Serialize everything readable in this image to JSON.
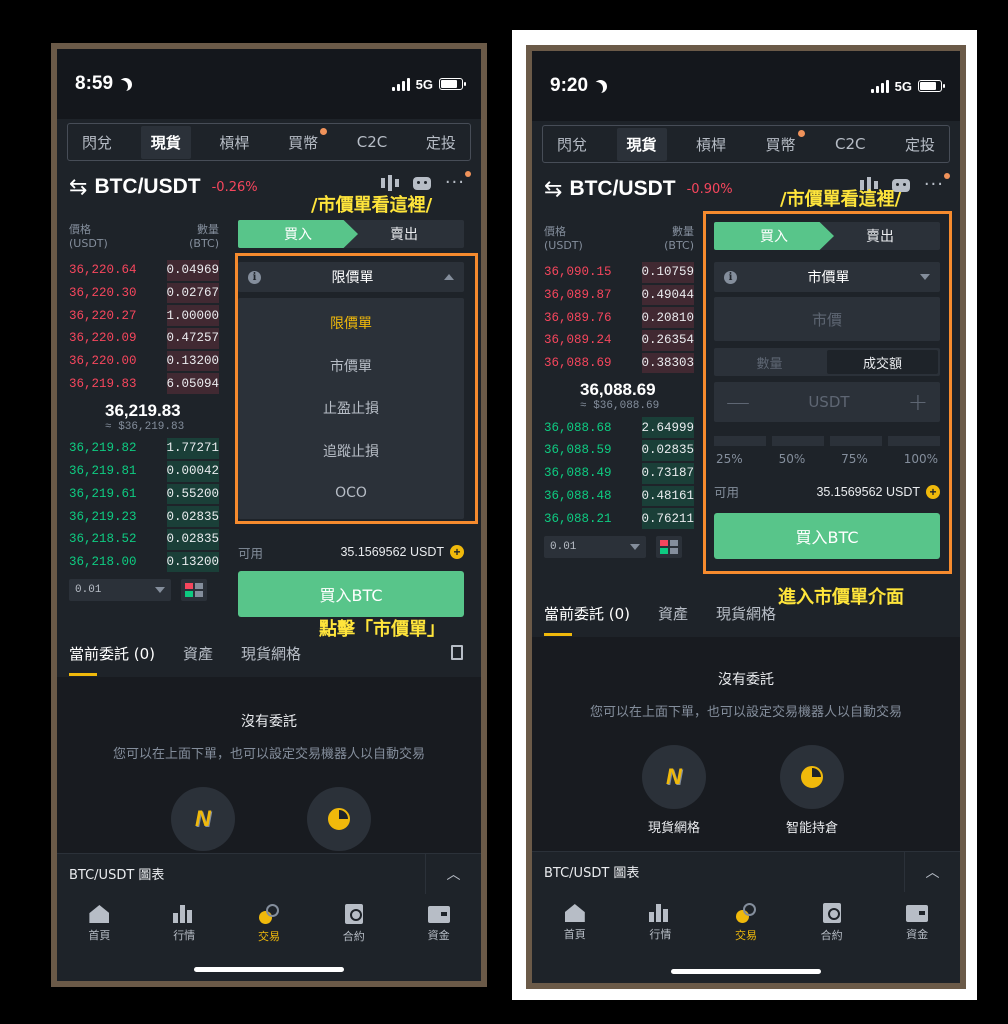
{
  "left": {
    "time": "8:59",
    "network": "5G",
    "tabs": [
      "閃兌",
      "現貨",
      "槓桿",
      "買幣",
      "C2C",
      "定投"
    ],
    "pair": "BTC/USDT",
    "change": "-0.26%",
    "ob_header": {
      "price": "價格",
      "price_unit": "(USDT)",
      "qty": "數量",
      "qty_unit": "(BTC)"
    },
    "asks": [
      {
        "price": "36,220.64",
        "qty": "0.04969",
        "depth": 0.35
      },
      {
        "price": "36,220.30",
        "qty": "0.02767",
        "depth": 0.35
      },
      {
        "price": "36,220.27",
        "qty": "1.00000",
        "depth": 0.35
      },
      {
        "price": "36,220.09",
        "qty": "0.47257",
        "depth": 0.35
      },
      {
        "price": "36,220.00",
        "qty": "0.13200",
        "depth": 0.35
      },
      {
        "price": "36,219.83",
        "qty": "6.05094",
        "depth": 0.35
      }
    ],
    "mid_price": "36,219.83",
    "mid_fiat": "≈ $36,219.83",
    "bids": [
      {
        "price": "36,219.82",
        "qty": "1.77271",
        "depth": 0.35
      },
      {
        "price": "36,219.81",
        "qty": "0.00042",
        "depth": 0.35
      },
      {
        "price": "36,219.61",
        "qty": "0.55200",
        "depth": 0.35
      },
      {
        "price": "36,219.23",
        "qty": "0.02835",
        "depth": 0.35
      },
      {
        "price": "36,218.52",
        "qty": "0.02835",
        "depth": 0.35
      },
      {
        "price": "36,218.00",
        "qty": "0.13200",
        "depth": 0.35
      }
    ],
    "precision": "0.01",
    "buy_tab": "買入",
    "sell_tab": "賣出",
    "order_type": "限價單",
    "dropdown_options": [
      "限價單",
      "市價單",
      "止盈止損",
      "追蹤止損",
      "OCO"
    ],
    "available_label": "可用",
    "available_value": "35.1569562 USDT",
    "buy_button": "買入BTC",
    "orders_tabs": [
      "當前委託 (0)",
      "資產",
      "現貨網格"
    ],
    "empty_title": "沒有委託",
    "empty_sub": "您可以在上面下單，也可以設定交易機器人以自動交易",
    "chart_label": "BTC/USDT 圖表",
    "nav": [
      "首頁",
      "行情",
      "交易",
      "合約",
      "資金"
    ],
    "annot_top": "/市價單看這裡/",
    "annot_bottom": "點擊「市價單」"
  },
  "right": {
    "time": "9:20",
    "network": "5G",
    "tabs": [
      "閃兌",
      "現貨",
      "槓桿",
      "買幣",
      "C2C",
      "定投"
    ],
    "pair": "BTC/USDT",
    "change": "-0.90%",
    "ob_header": {
      "price": "價格",
      "price_unit": "(USDT)",
      "qty": "數量",
      "qty_unit": "(BTC)"
    },
    "asks": [
      {
        "price": "36,090.15",
        "qty": "0.10759",
        "depth": 0.35
      },
      {
        "price": "36,089.87",
        "qty": "0.49044",
        "depth": 0.35
      },
      {
        "price": "36,089.76",
        "qty": "0.20810",
        "depth": 0.35
      },
      {
        "price": "36,089.24",
        "qty": "0.26354",
        "depth": 0.35
      },
      {
        "price": "36,088.69",
        "qty": "0.38303",
        "depth": 0.35
      }
    ],
    "mid_price": "36,088.69",
    "mid_fiat": "≈ $36,088.69",
    "bids": [
      {
        "price": "36,088.68",
        "qty": "2.64999",
        "depth": 0.35
      },
      {
        "price": "36,088.59",
        "qty": "0.02835",
        "depth": 0.35
      },
      {
        "price": "36,088.49",
        "qty": "0.73187",
        "depth": 0.35
      },
      {
        "price": "36,088.48",
        "qty": "0.48161",
        "depth": 0.35
      },
      {
        "price": "36,088.21",
        "qty": "0.76211",
        "depth": 0.35
      }
    ],
    "precision": "0.01",
    "buy_tab": "買入",
    "sell_tab": "賣出",
    "order_type": "市價單",
    "price_field": "市價",
    "seg_qty": "數量",
    "seg_total": "成交額",
    "amount_unit": "USDT",
    "percents": [
      "25%",
      "50%",
      "75%",
      "100%"
    ],
    "available_label": "可用",
    "available_value": "35.1569562 USDT",
    "buy_button": "買入BTC",
    "orders_tabs": [
      "當前委託 (0)",
      "資產",
      "現貨網格"
    ],
    "empty_title": "沒有委託",
    "empty_sub": "您可以在上面下單，也可以設定交易機器人以自動交易",
    "bot_labels": [
      "現貨網格",
      "智能持倉"
    ],
    "chart_label": "BTC/USDT 圖表",
    "nav": [
      "首頁",
      "行情",
      "交易",
      "合約",
      "資金"
    ],
    "annot_top": "/市價單看這裡/",
    "annot_bottom": "進入市價單介面"
  },
  "colors": {
    "accent": "#f0b90b",
    "buy": "#58c58a",
    "ask": "#f6465d",
    "bid": "#0ecb81",
    "highlight": "#f68b2e",
    "annotation": "#ffe53b"
  }
}
